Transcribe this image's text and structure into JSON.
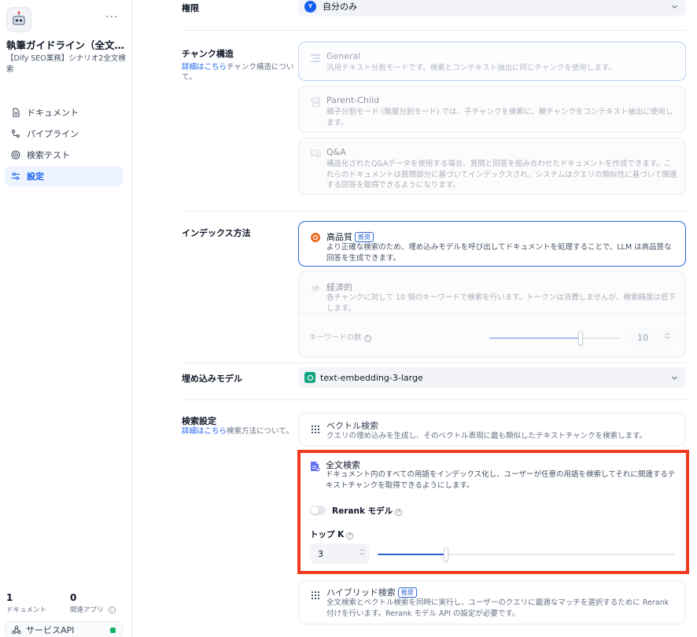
{
  "sidebar": {
    "app_title": "執筆ガイドライン（全文検索）",
    "app_desc": "【Dify SEO業務】シナリオ2全文検索",
    "more": "···",
    "nav": [
      {
        "label": "ドキュメント",
        "icon": "document-icon"
      },
      {
        "label": "パイプライン",
        "icon": "pipeline-icon"
      },
      {
        "label": "検索テスト",
        "icon": "target-icon"
      },
      {
        "label": "設定",
        "icon": "settings-icon"
      }
    ],
    "stats": {
      "docs_count": "1",
      "docs_label": "ドキュメント",
      "apps_count": "0",
      "apps_label": "関連アプリ"
    },
    "api_label": "サービスAPI"
  },
  "permission": {
    "label": "権限",
    "avatar_letter": "Y",
    "value": "自分のみ"
  },
  "chunk": {
    "label": "チャンク構造",
    "link": "詳細はこちら",
    "desc": "チャンク構造について。",
    "options": [
      {
        "title": "General",
        "desc": "汎用テキスト分割モードです。検索とコンテキスト抽出に同じチャンクを使用します。"
      },
      {
        "title": "Parent-Child",
        "desc": "親子分割モード (階層分割モード) では、子チャンクを検索に、親チャンクをコンテキスト抽出に使用します。"
      },
      {
        "title": "Q&A",
        "desc": "構造化されたQ&Aデータを使用する場合、質問と回答を組み合わせたドキュメントを作成できます。これらのドキュメントは質問部分に基づいてインデックスされ、システムはクエリの類似性に基づいて関連する回答を取得できるようになります。"
      }
    ]
  },
  "index": {
    "label": "インデックス方法",
    "high": {
      "title": "高品質",
      "badge": "推奨",
      "desc": "より正確な検索のため、埋め込みモデルを呼び出してドキュメントを処理することで、LLM は高品質な回答を生成できます。"
    },
    "economy": {
      "title": "経済的",
      "desc": "各チャンクに対して 10 個のキーワードで検索を行います。トークンは消費しませんが、検索精度は低下します。",
      "keywords_label": "キーワードの数",
      "keywords_value": "10",
      "keywords_fraction": 0.7
    }
  },
  "embedding": {
    "label": "埋め込みモデル",
    "value": "text-embedding-3-large"
  },
  "retrieval": {
    "label": "検索設定",
    "link": "詳細はこちら",
    "desc": "検索方法について。",
    "vector": {
      "title": "ベクトル検索",
      "desc": "クエリの埋め込みを生成し、そのベクトル表現に最も類似したテキストチャンクを検索します。"
    },
    "fulltext": {
      "title": "全文検索",
      "desc": "ドキュメント内のすべての用語をインデックス化し、ユーザーが任意の用語を検索してそれに関連するテキストチャンクを取得できるようにします。",
      "rerank_label": "Rerank モデル",
      "topk_label": "トップ K",
      "topk_value": "3",
      "topk_fraction": 0.23
    },
    "hybrid": {
      "title": "ハイブリッド検索",
      "badge": "推奨",
      "desc": "全文検索とベクトル検索を同時に実行し、ユーザーのクエリに最適なマッチを選択するために Rerank 付けを行います。Rerank モデル API の設定が必要です。"
    }
  },
  "colors": {
    "accent": "#155eef",
    "highlight": "#f23a20"
  }
}
